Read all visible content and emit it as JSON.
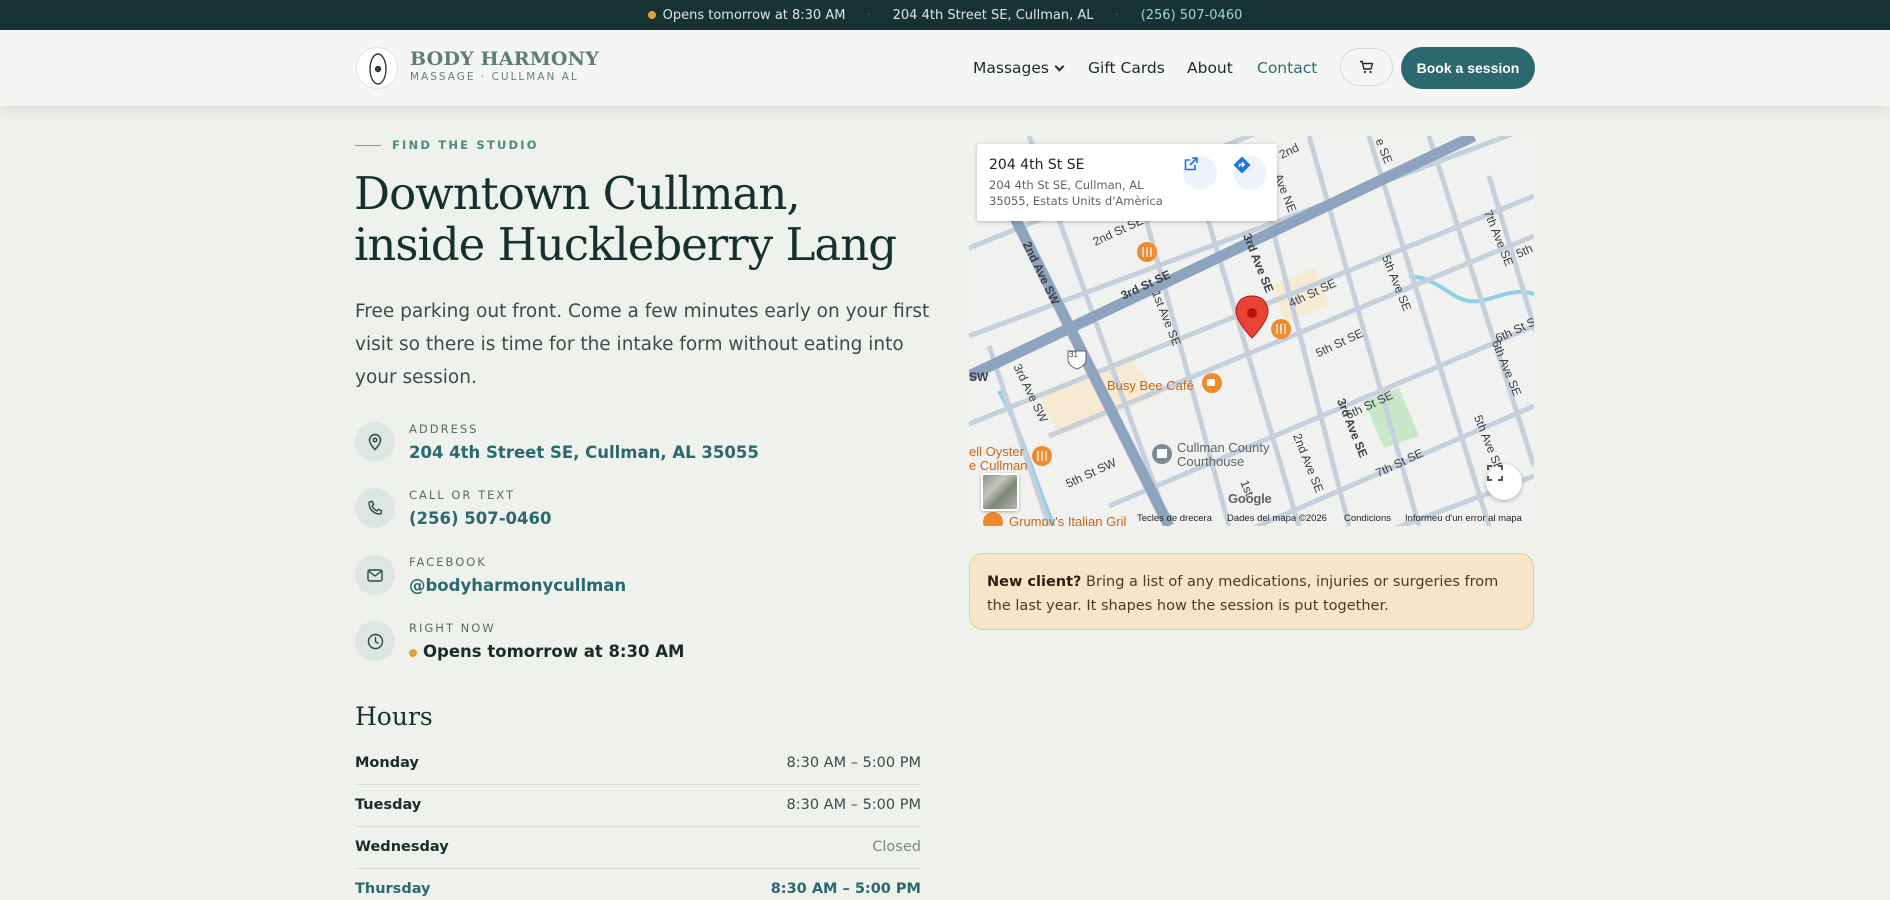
{
  "topbar": {
    "status": "Opens tomorrow at 8:30 AM",
    "address": "204 4th Street SE, Cullman, AL",
    "phone": "(256) 507-0460",
    "separator": "·"
  },
  "brand": {
    "name": "BODY HARMONY",
    "tagline": "MASSAGE · CULLMAN AL"
  },
  "nav": {
    "items": [
      {
        "label": "Massages"
      },
      {
        "label": "Gift Cards"
      },
      {
        "label": "About"
      },
      {
        "label": "Contact"
      }
    ],
    "cta": "Book a session"
  },
  "hero": {
    "eyebrow": "FIND THE STUDIO",
    "headline_line1": "Downtown Cullman,",
    "headline_line2": "inside Huckleberry Lang",
    "lead": "Free parking out front. Come a few minutes early on your first visit so there is time for the intake form without eating into your session."
  },
  "info": [
    {
      "label": "ADDRESS",
      "value": "204 4th Street SE, Cullman, AL 35055",
      "icon": "map-pin-icon"
    },
    {
      "label": "CALL OR TEXT",
      "value": "(256) 507-0460",
      "icon": "phone-icon"
    },
    {
      "label": "FACEBOOK",
      "value": "@bodyharmonycullman",
      "icon": "mail-icon"
    },
    {
      "label": "RIGHT NOW",
      "value": "Opens tomorrow at 8:30 AM",
      "icon": "clock-icon"
    }
  ],
  "hours": {
    "title": "Hours",
    "rows": [
      {
        "day": "Monday",
        "time": "8:30 AM – 5:00 PM"
      },
      {
        "day": "Tuesday",
        "time": "8:30 AM – 5:00 PM"
      },
      {
        "day": "Wednesday",
        "time": "Closed"
      },
      {
        "day": "Thursday",
        "time": "8:30 AM – 5:00 PM"
      }
    ]
  },
  "map": {
    "card_title": "204 4th St SE",
    "card_address": "204 4th St SE, Cullman, AL 35055, Estats Units d'Amèrica",
    "labels": {
      "ave_2nd_sw": "2nd Ave SW",
      "st_3rd_se": "3rd St SE",
      "st_2nd_se": "2nd St SE",
      "st_2nd": "2nd",
      "ave_1st_se": "1st Ave SE",
      "ave_3rd_se_top": "3rd Ave SE",
      "ave_ne": "Ave NE",
      "st_4th_se": "4th St SE",
      "st_5th_se": "5th St SE",
      "st_6th_se": "6th St SE",
      "st_7th_se": "7th St SE",
      "st_5th_sw": "5th St SW",
      "ave_3rd_sw": "3rd Ave SW",
      "ave_5th_se": "5th Ave SE",
      "ave_6th_se": "6th Ave SE",
      "ave_7th_se": "7th Ave SE",
      "ave_2nd_se": "2nd Ave SE",
      "ave_3rd_se": "3rd Ave SE",
      "ave_5th_se_b": "5th Ave SE",
      "ave_1st": "1st",
      "sw": "SW",
      "st_6th_s": "6th St S",
      "st_5th": "5th",
      "ave_se_top": "e SE",
      "busy_bee": "Busy Bee Café",
      "courthouse_1": "Cullman County",
      "courthouse_2": "Courthouse",
      "oyster_1": "ell Oyster",
      "oyster_2": "e Cullman",
      "grumpys": "Grumpy's Italian Gril",
      "shield": "31"
    },
    "google": "Google",
    "footer": [
      "Tecles de drecera",
      "Dades del mapa ©2026",
      "Condicions",
      "Informeu d'un error al mapa"
    ]
  },
  "note": {
    "strong": "New client?",
    "text": " Bring a list of any medications, injuries or surgeries from the last year. It shapes how the session is put together."
  },
  "colors": {
    "accent": "#2b6870",
    "topbar": "#173233",
    "status": "#e0a23a",
    "note_bg": "#f6e5c6"
  }
}
